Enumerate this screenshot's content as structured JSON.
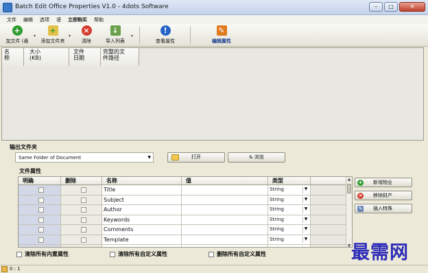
{
  "window": {
    "title": "Batch Edit Office Properties V1.0 - 4dots Software",
    "min": "–",
    "max": "□",
    "close": "✕"
  },
  "menu": [
    "文件",
    "编辑",
    "选项",
    "语",
    "立即购买",
    "帮助"
  ],
  "toolbar": {
    "add_file": "加文件 (悬",
    "add_folder": "添加文件夹",
    "clear": "清除",
    "import_list": "导入列表",
    "view_props": "查看属性",
    "edit_props": "编辑属性",
    "icons": {
      "add_file": "green-plus-icon",
      "add_folder": "folder-icon",
      "clear": "red-x-icon",
      "import": "import-icon",
      "view": "blue-info-icon",
      "edit": "edit-icon"
    },
    "colors": {
      "green": "#2e9c2e",
      "red": "#d53b2c",
      "blue": "#2462c7",
      "orange": "#e07a1f"
    }
  },
  "file_list": {
    "columns": [
      "名\n称",
      "大小\n(KB)",
      "文件\n日期",
      "完整的文\n件路径"
    ]
  },
  "output": {
    "label": "输出文件夹",
    "selected": "Same Folder of Document",
    "open_button": "打开",
    "browse_button": "& 浏览"
  },
  "file_props": {
    "label": "文件属性",
    "columns": {
      "clear": "明确",
      "delete": "删除",
      "name": "名称",
      "value": "值",
      "type": "类型"
    },
    "rows": [
      {
        "name": "Title",
        "value": "",
        "type": "String"
      },
      {
        "name": "Subject",
        "value": "",
        "type": "String"
      },
      {
        "name": "Author",
        "value": "",
        "type": "String"
      },
      {
        "name": "Keywords",
        "value": "",
        "type": "String"
      },
      {
        "name": "Comments",
        "value": "",
        "type": "String"
      },
      {
        "name": "Template",
        "value": "",
        "type": "String"
      },
      {
        "name": "",
        "value": "",
        "type": "String"
      }
    ]
  },
  "side_buttons": {
    "new": "新增物业",
    "remove": "移除财产",
    "insert": "插入特殊"
  },
  "bottom": {
    "clear_builtin": "清除所有内置属性",
    "clear_custom": "清除所有自定义属性",
    "delete_custom": "删除所有自定义属性"
  },
  "watermark": "最需网",
  "status": "0 : 1"
}
